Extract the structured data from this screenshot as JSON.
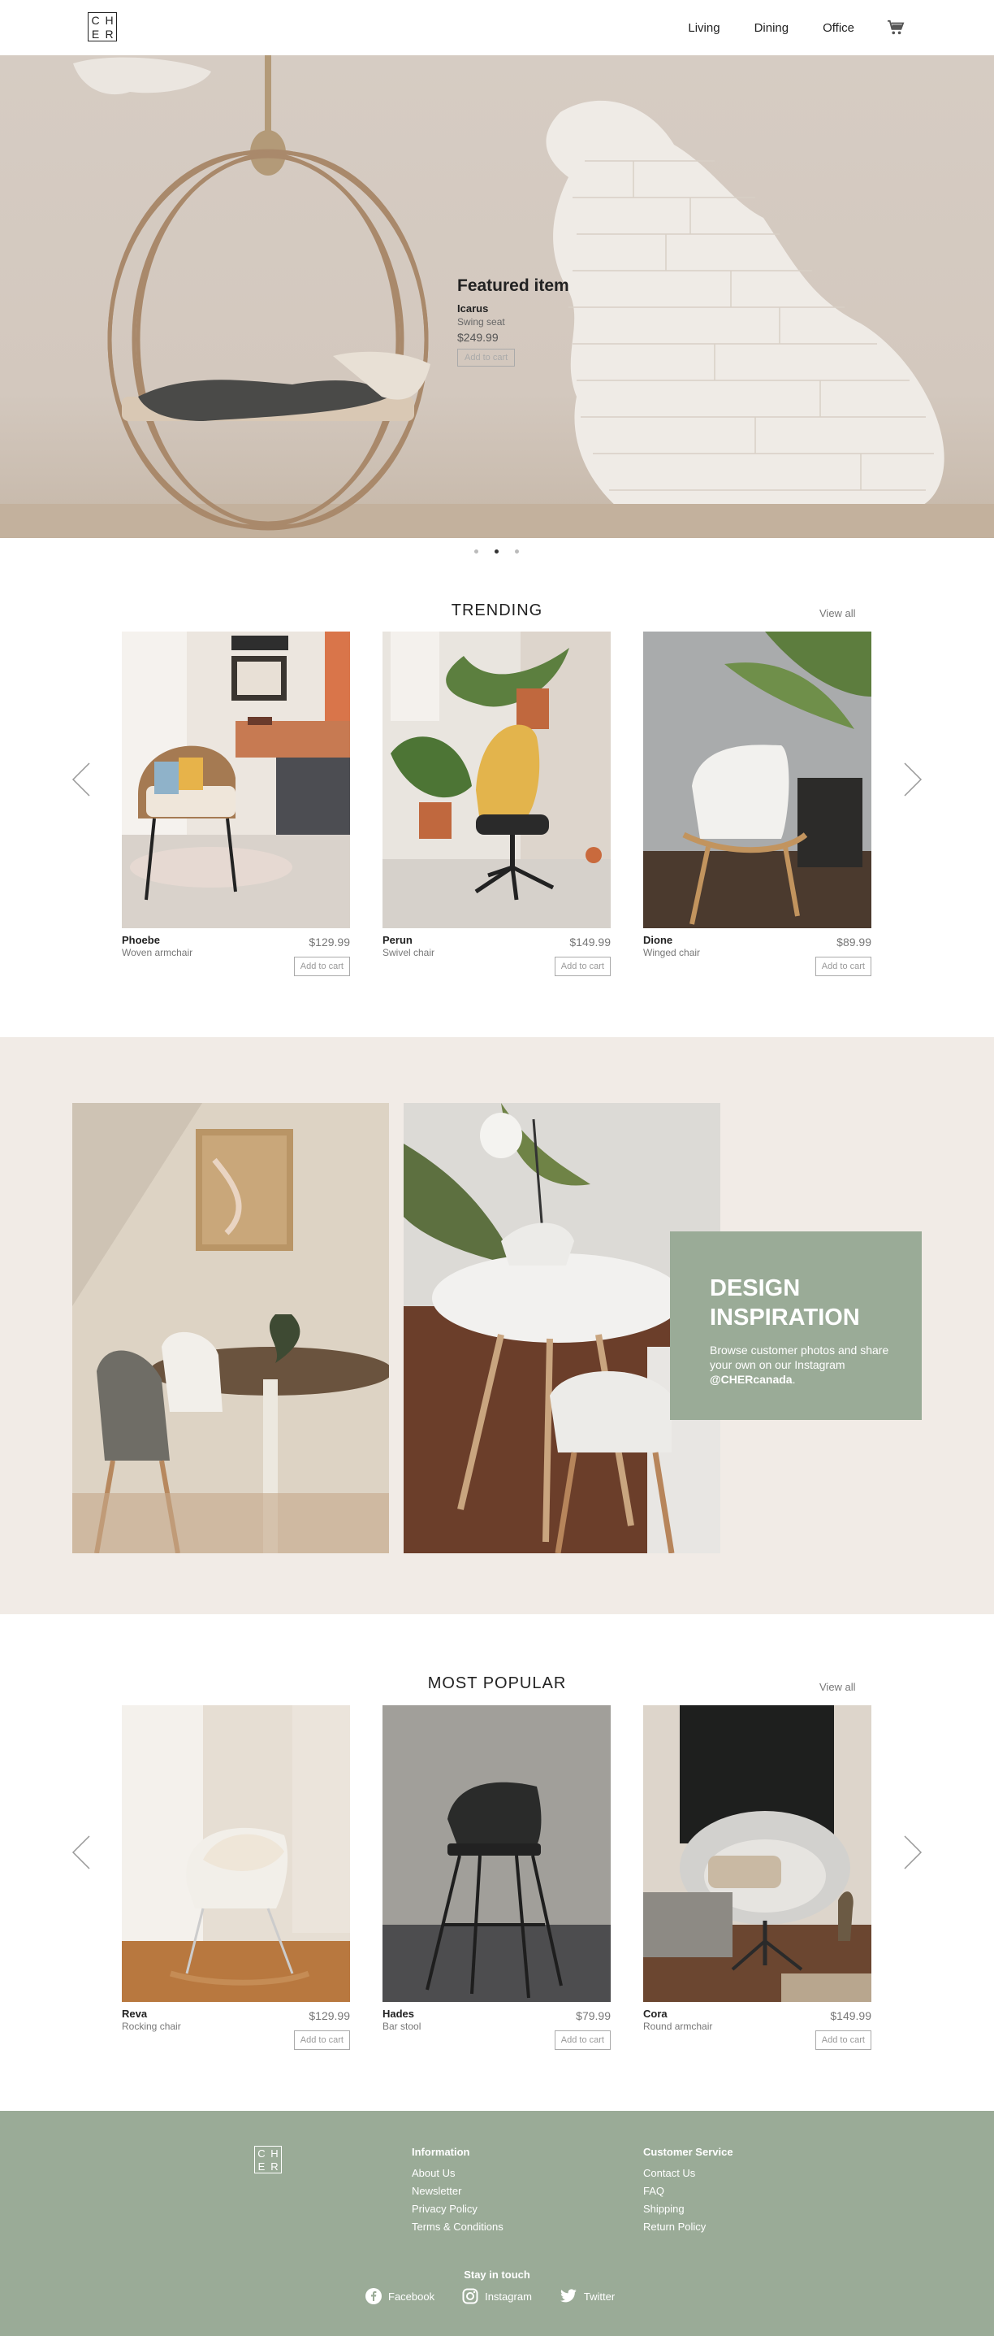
{
  "header": {
    "logo_letters": [
      "C",
      "H",
      "E",
      "R"
    ],
    "nav": [
      "Living",
      "Dining",
      "Office"
    ]
  },
  "hero": {
    "title": "Featured item",
    "name": "Icarus",
    "subtitle": "Swing seat",
    "price": "$249.99",
    "button": "Add to cart",
    "slide_count": 3,
    "active_slide": 2
  },
  "trending": {
    "title": "TRENDING",
    "view_all": "View all",
    "products": [
      {
        "name": "Phoebe",
        "subtitle": "Woven armchair",
        "price": "$129.99",
        "button": "Add to cart"
      },
      {
        "name": "Perun",
        "subtitle": "Swivel chair",
        "price": "$149.99",
        "button": "Add to cart"
      },
      {
        "name": "Dione",
        "subtitle": "Winged chair",
        "price": "$89.99",
        "button": "Add to cart"
      }
    ]
  },
  "inspiration": {
    "heading_line1": "DESIGN",
    "heading_line2": "INSPIRATION",
    "text": "Browse customer photos and share your own on our Instagram ",
    "handle": "@CHERcanada",
    "text_end": "."
  },
  "popular": {
    "title": "MOST POPULAR",
    "view_all": "View all",
    "products": [
      {
        "name": "Reva",
        "subtitle": "Rocking chair",
        "price": "$129.99",
        "button": "Add to cart"
      },
      {
        "name": "Hades",
        "subtitle": "Bar stool",
        "price": "$79.99",
        "button": "Add to cart"
      },
      {
        "name": "Cora",
        "subtitle": "Round armchair",
        "price": "$149.99",
        "button": "Add to cart"
      }
    ]
  },
  "footer": {
    "logo_letters": [
      "C",
      "H",
      "E",
      "R"
    ],
    "information": {
      "heading": "Information",
      "links": [
        "About Us",
        "Newsletter",
        "Privacy Policy",
        "Terms & Conditions"
      ]
    },
    "customer_service": {
      "heading": "Customer Service",
      "links": [
        "Contact Us",
        "FAQ",
        "Shipping",
        "Return Policy"
      ]
    },
    "stay_in_touch": "Stay in touch",
    "social": [
      "Facebook",
      "Instagram",
      "Twitter"
    ]
  },
  "colors": {
    "sage": "#9aab97",
    "cream": "#f1ebe6"
  }
}
